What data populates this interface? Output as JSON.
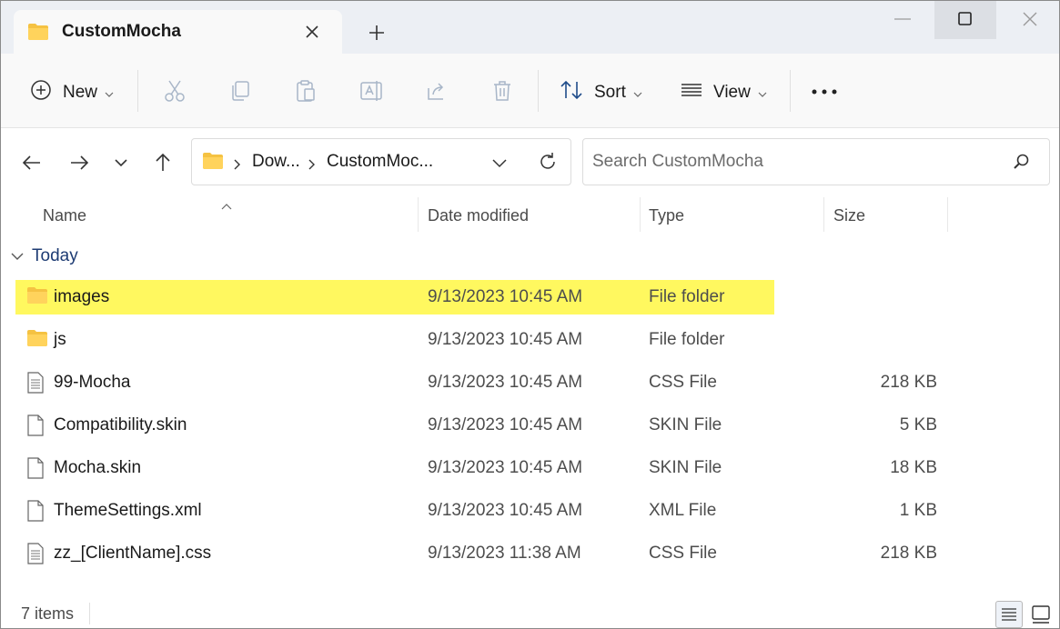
{
  "window": {
    "tab_title": "CustomMocha"
  },
  "toolbar": {
    "new_label": "New",
    "sort_label": "Sort",
    "view_label": "View"
  },
  "address": {
    "crumbs": [
      "Dow...",
      "CustomMoc..."
    ]
  },
  "search": {
    "placeholder": "Search CustomMocha"
  },
  "columns": {
    "name": "Name",
    "date": "Date modified",
    "type": "Type",
    "size": "Size"
  },
  "group": {
    "label": "Today"
  },
  "files": [
    {
      "name": "images",
      "date": "9/13/2023 10:45 AM",
      "type": "File folder",
      "size": "",
      "icon": "folder-icon",
      "selected": true
    },
    {
      "name": "js",
      "date": "9/13/2023 10:45 AM",
      "type": "File folder",
      "size": "",
      "icon": "folder-icon",
      "selected": false
    },
    {
      "name": "99-Mocha",
      "date": "9/13/2023 10:45 AM",
      "type": "CSS File",
      "size": "218 KB",
      "icon": "text-file-icon",
      "selected": false
    },
    {
      "name": "Compatibility.skin",
      "date": "9/13/2023 10:45 AM",
      "type": "SKIN File",
      "size": "5 KB",
      "icon": "blank-file-icon",
      "selected": false
    },
    {
      "name": "Mocha.skin",
      "date": "9/13/2023 10:45 AM",
      "type": "SKIN File",
      "size": "18 KB",
      "icon": "blank-file-icon",
      "selected": false
    },
    {
      "name": "ThemeSettings.xml",
      "date": "9/13/2023 10:45 AM",
      "type": "XML File",
      "size": "1 KB",
      "icon": "blank-file-icon",
      "selected": false
    },
    {
      "name": "zz_[ClientName].css",
      "date": "9/13/2023 11:38 AM",
      "type": "CSS File",
      "size": "218 KB",
      "icon": "text-file-icon",
      "selected": false
    }
  ],
  "status": {
    "item_count": "7 items"
  },
  "colors": {
    "highlight": "#fff85f",
    "folder": "#f5c242",
    "group_label": "#1d3b73"
  }
}
